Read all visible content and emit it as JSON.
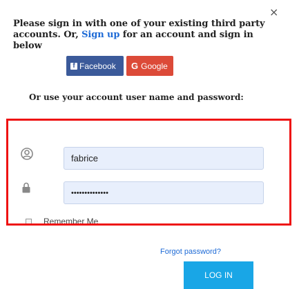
{
  "dialog": {
    "close_glyph": "×"
  },
  "intro": {
    "line1": "Please sign in with one of your existing third party",
    "line2_before": "accounts. Or, ",
    "sign_up_link": "Sign up",
    "line2_after": " for an account and sign in below"
  },
  "social": {
    "facebook_label": "Facebook",
    "facebook_icon": "facebook-icon",
    "google_label": "Google",
    "google_icon_glyph": "G"
  },
  "alt_login_heading": "Or use your account user name and password:",
  "form": {
    "username_value": "fabrice",
    "username_icon": "user-circle-icon",
    "password_value": "••••••••••••••",
    "password_icon": "lock-icon",
    "remember_label": "Remember Me",
    "highlight_color": "#ee1111"
  },
  "forgot_password_label": "Forgot password?",
  "login_button_label": "LOG IN",
  "colors": {
    "facebook": "#3b5a9a",
    "google": "#dc4a38",
    "link": "#1d6ad6",
    "login": "#19a6e6",
    "field_bg": "#e8effc"
  }
}
